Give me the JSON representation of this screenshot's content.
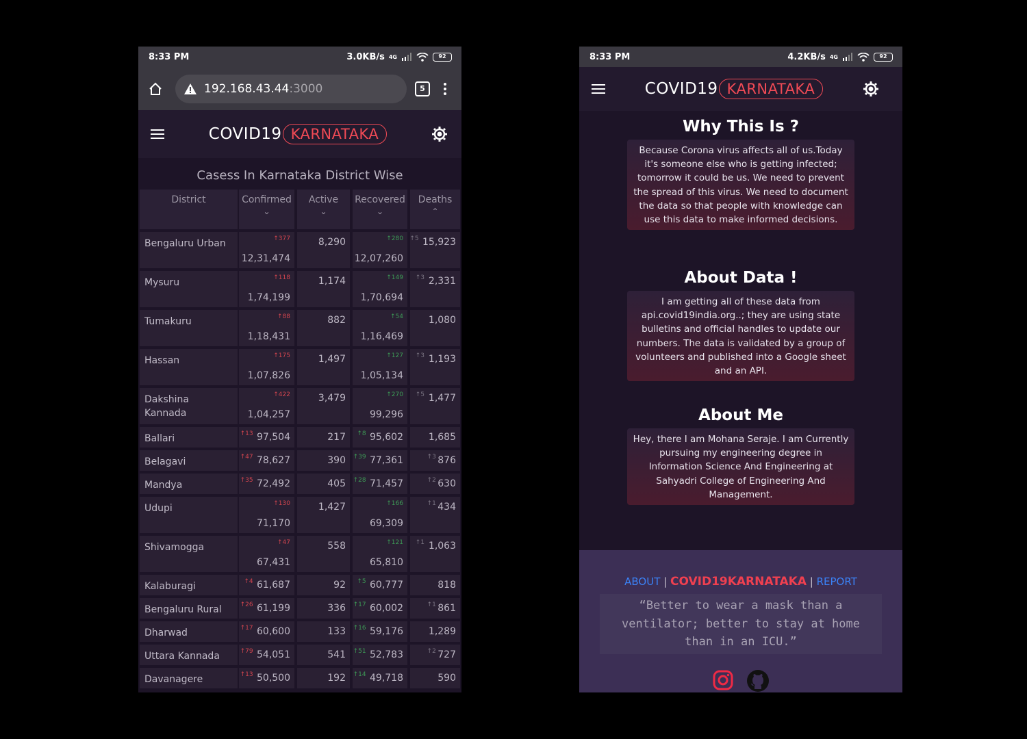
{
  "left_phone": {
    "status": {
      "time": "8:33 PM",
      "speed": "3.0KB/s",
      "net": "4G",
      "battery": "92"
    },
    "browser": {
      "url_host": "192.168.43.44",
      "url_port": ":3000",
      "tab_count": "5"
    },
    "app": {
      "brand": "COVID19",
      "brand_pill": "KARNATAKA"
    },
    "table": {
      "title": "Casess In Karnataka District Wise",
      "headers": [
        "District",
        "Confirmed",
        "Active",
        "Recovered",
        "Deaths"
      ],
      "sort_icons": [
        "⌄",
        "⌄",
        "⌄",
        "⌃"
      ],
      "rows": [
        {
          "district": "Bengaluru Urban",
          "confirmed": "12,31,474",
          "confirmed_delta": "↑377",
          "active": "8,290",
          "recovered": "12,07,260",
          "recovered_delta": "↑280",
          "deaths": "15,923",
          "deaths_delta": "↑5"
        },
        {
          "district": "Mysuru",
          "confirmed": "1,74,199",
          "confirmed_delta": "↑118",
          "active": "1,174",
          "recovered": "1,70,694",
          "recovered_delta": "↑149",
          "deaths": "2,331",
          "deaths_delta": "↑3"
        },
        {
          "district": "Tumakuru",
          "confirmed": "1,18,431",
          "confirmed_delta": "↑88",
          "active": "882",
          "recovered": "1,16,469",
          "recovered_delta": "↑54",
          "deaths": "1,080",
          "deaths_delta": ""
        },
        {
          "district": "Hassan",
          "confirmed": "1,07,826",
          "confirmed_delta": "↑175",
          "active": "1,497",
          "recovered": "1,05,134",
          "recovered_delta": "↑127",
          "deaths": "1,193",
          "deaths_delta": "↑3"
        },
        {
          "district": "Dakshina Kannada",
          "confirmed": "1,04,257",
          "confirmed_delta": "↑422",
          "active": "3,479",
          "recovered": "99,296",
          "recovered_delta": "↑270",
          "deaths": "1,477",
          "deaths_delta": "↑5"
        },
        {
          "district": "Ballari",
          "confirmed": "97,504",
          "confirmed_delta": "↑13",
          "active": "217",
          "recovered": "95,602",
          "recovered_delta": "↑8",
          "deaths": "1,685",
          "deaths_delta": ""
        },
        {
          "district": "Belagavi",
          "confirmed": "78,627",
          "confirmed_delta": "↑47",
          "active": "390",
          "recovered": "77,361",
          "recovered_delta": "↑39",
          "deaths": "876",
          "deaths_delta": "↑3"
        },
        {
          "district": "Mandya",
          "confirmed": "72,492",
          "confirmed_delta": "↑35",
          "active": "405",
          "recovered": "71,457",
          "recovered_delta": "↑28",
          "deaths": "630",
          "deaths_delta": "↑2"
        },
        {
          "district": "Udupi",
          "confirmed": "71,170",
          "confirmed_delta": "↑130",
          "active": "1,427",
          "recovered": "69,309",
          "recovered_delta": "↑166",
          "deaths": "434",
          "deaths_delta": "↑1"
        },
        {
          "district": "Shivamogga",
          "confirmed": "67,431",
          "confirmed_delta": "↑47",
          "active": "558",
          "recovered": "65,810",
          "recovered_delta": "↑121",
          "deaths": "1,063",
          "deaths_delta": "↑1"
        },
        {
          "district": "Kalaburagi",
          "confirmed": "61,687",
          "confirmed_delta": "↑4",
          "active": "92",
          "recovered": "60,777",
          "recovered_delta": "↑5",
          "deaths": "818",
          "deaths_delta": ""
        },
        {
          "district": "Bengaluru Rural",
          "confirmed": "61,199",
          "confirmed_delta": "↑26",
          "active": "336",
          "recovered": "60,002",
          "recovered_delta": "↑17",
          "deaths": "861",
          "deaths_delta": "↑1"
        },
        {
          "district": "Dharwad",
          "confirmed": "60,600",
          "confirmed_delta": "↑17",
          "active": "133",
          "recovered": "59,176",
          "recovered_delta": "↑16",
          "deaths": "1,289",
          "deaths_delta": ""
        },
        {
          "district": "Uttara Kannada",
          "confirmed": "54,051",
          "confirmed_delta": "↑79",
          "active": "541",
          "recovered": "52,783",
          "recovered_delta": "↑51",
          "deaths": "727",
          "deaths_delta": "↑2"
        },
        {
          "district": "Davanagere",
          "confirmed": "50,500",
          "confirmed_delta": "↑13",
          "active": "192",
          "recovered": "49,718",
          "recovered_delta": "↑14",
          "deaths": "590",
          "deaths_delta": ""
        }
      ]
    }
  },
  "right_phone": {
    "status": {
      "time": "8:33 PM",
      "speed": "4.2KB/s",
      "net": "4G",
      "battery": "92"
    },
    "app": {
      "brand": "COVID19",
      "brand_pill": "KARNATAKA"
    },
    "sections": [
      {
        "heading": "Why This Is ?",
        "body": "Because Corona virus affects all of us.Today it's someone else who is getting infected; tomorrow it could be us. We need to prevent the spread of this virus. We need to document the data so that people with knowledge can use this data to make informed decisions."
      },
      {
        "heading": "About Data !",
        "body": "I am getting all of these data from api.covid19india.org..; they are using state bulletins and official handles to update our numbers. The data is validated by a group of volunteers and published into a Google sheet and an API."
      },
      {
        "heading": "About Me",
        "body": "Hey, there I am Mohana Seraje. I am Currently pursuing my engineering degree in Information Science And Engineering at Sahyadri College of Engineering And Management."
      }
    ],
    "footer": {
      "link_about": "ABOUT",
      "separator": "|",
      "brand": "COVID19KARNATAKA",
      "link_report": "REPORT",
      "quote": "“Better to wear a mask than a ventilator; better to stay at home than in an ICU.”",
      "icons": [
        "instagram-icon",
        "github-icon"
      ]
    }
  },
  "colors": {
    "accent_red": "#f04a55",
    "link_blue": "#3b82f6",
    "bg_dark": "#1d1427",
    "footer_bg": "#3c2f55"
  }
}
